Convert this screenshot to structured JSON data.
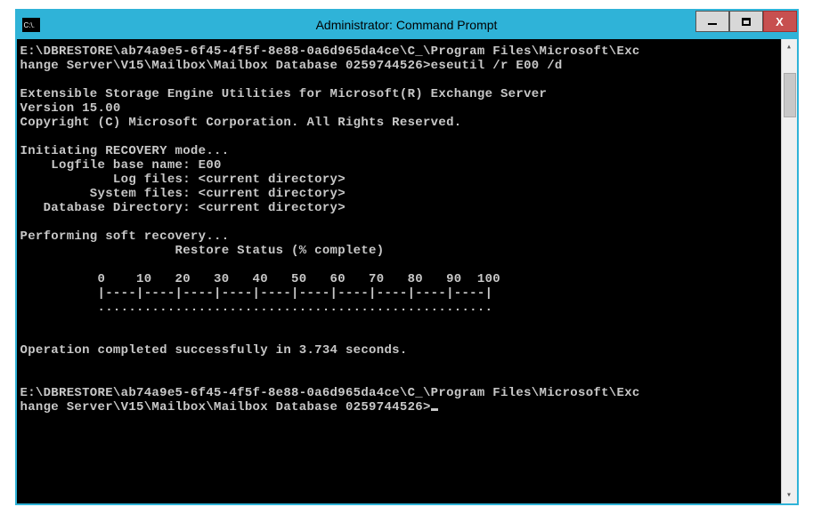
{
  "window": {
    "icon_text": "C:\\.",
    "title": "Administrator: Command Prompt"
  },
  "controls": {
    "minimize": "minimize",
    "maximize": "maximize",
    "close": "X"
  },
  "console": {
    "line1": "E:\\DBRESTORE\\ab74a9e5-6f45-4f5f-8e88-0a6d965da4ce\\C_\\Program Files\\Microsoft\\Exc",
    "line2": "hange Server\\V15\\Mailbox\\Mailbox Database 0259744526>eseutil /r E00 /d",
    "line3": "",
    "line4": "Extensible Storage Engine Utilities for Microsoft(R) Exchange Server",
    "line5": "Version 15.00",
    "line6": "Copyright (C) Microsoft Corporation. All Rights Reserved.",
    "line7": "",
    "line8": "Initiating RECOVERY mode...",
    "line9": "    Logfile base name: E00",
    "line10": "            Log files: <current directory>",
    "line11": "         System files: <current directory>",
    "line12": "   Database Directory: <current directory>",
    "line13": "",
    "line14": "Performing soft recovery...",
    "line15": "                    Restore Status (% complete)",
    "line16": "",
    "line17": "          0    10   20   30   40   50   60   70   80   90  100",
    "line18": "          |----|----|----|----|----|----|----|----|----|----|",
    "line19": "          ...................................................",
    "line20": "",
    "line21": "",
    "line22": "Operation completed successfully in 3.734 seconds.",
    "line23": "",
    "line24": "",
    "line25": "E:\\DBRESTORE\\ab74a9e5-6f45-4f5f-8e88-0a6d965da4ce\\C_\\Program Files\\Microsoft\\Exc",
    "line26": "hange Server\\V15\\Mailbox\\Mailbox Database 0259744526>"
  }
}
